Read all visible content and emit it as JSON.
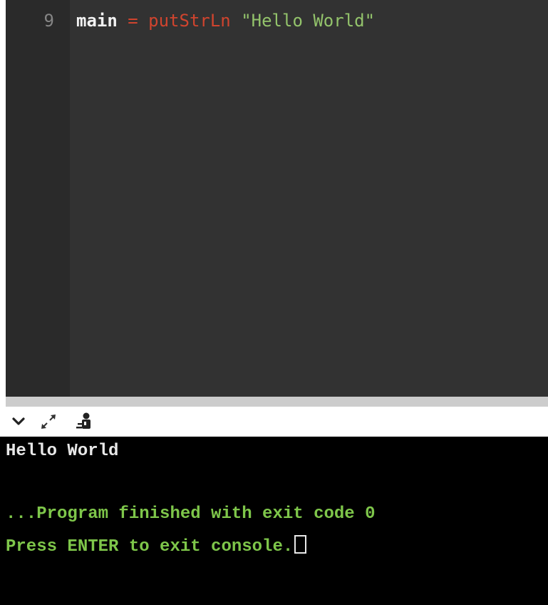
{
  "editor": {
    "line_number": "9",
    "tokens": {
      "ident": "main",
      "op": " = ",
      "fn": "putStrLn",
      "space": " ",
      "str": "\"Hello World\""
    }
  },
  "toolbar": {
    "icons": [
      "chevron-down-icon",
      "expand-icon",
      "debug-user-icon"
    ]
  },
  "console": {
    "output_line": "Hello World",
    "finished_line": "...Program finished with exit code 0",
    "press_line": "Press ENTER to exit console."
  },
  "colors": {
    "editor_bg": "#323232",
    "gutter_bg": "#2a2a2a",
    "keyword_red": "#d0442e",
    "string_green": "#93c36b",
    "console_green": "#7ec64a",
    "console_bg": "#000000"
  }
}
